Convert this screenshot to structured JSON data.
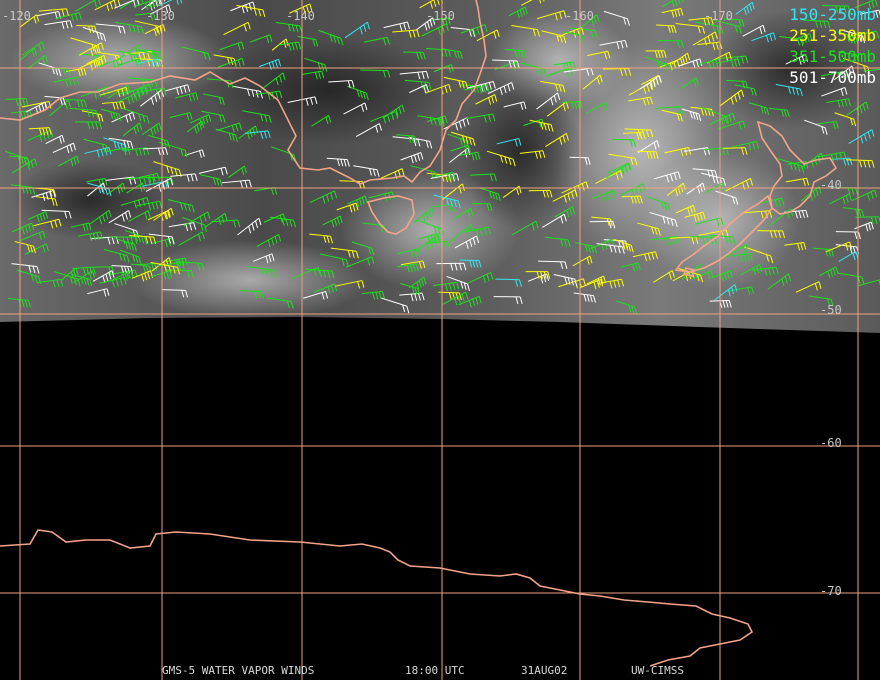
{
  "map": {
    "lon_labels": [
      "-120",
      "-130",
      "-140",
      "-150",
      "-160",
      "-170"
    ],
    "lat_labels": [
      "-40",
      "-50",
      "-60",
      "-70"
    ],
    "legend": [
      {
        "label": "150-250mb",
        "color": "#33e6f0"
      },
      {
        "label": "251-350mb",
        "color": "#ffff00"
      },
      {
        "label": "351-500mb",
        "color": "#1ee01e"
      },
      {
        "label": "501-700mb",
        "color": "#ffffff"
      }
    ],
    "footer": {
      "product": "GMS-5 WATER VAPOR WINDS",
      "time": "18:00 UTC",
      "date": "31AUG02",
      "source": "UW-CIMSS"
    },
    "colors": {
      "grid": "#f0a080",
      "coast": "#f4a488",
      "background": "#000000"
    }
  }
}
